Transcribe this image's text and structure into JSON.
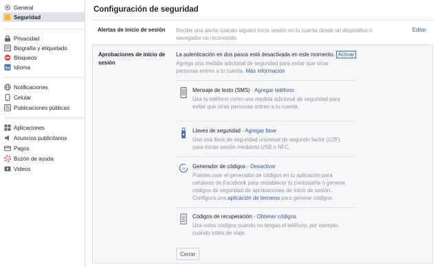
{
  "sidebar": {
    "items": [
      {
        "label": "General",
        "icon": "gear-icon"
      },
      {
        "label": "Seguridad",
        "icon": "shield-icon"
      },
      {
        "label": "Privacidad",
        "icon": "lock-icon"
      },
      {
        "label": "Biografía y etiquetado",
        "icon": "timeline-icon"
      },
      {
        "label": "Bloqueos",
        "icon": "block-icon"
      },
      {
        "label": "Idioma",
        "icon": "language-icon"
      },
      {
        "label": "Notificaciones",
        "icon": "globe-icon"
      },
      {
        "label": "Celular",
        "icon": "mobile-icon"
      },
      {
        "label": "Publicaciones públicas",
        "icon": "rss-icon"
      },
      {
        "label": "Aplicaciones",
        "icon": "apps-icon"
      },
      {
        "label": "Anuncios publicitarios",
        "icon": "ads-icon"
      },
      {
        "label": "Pagos",
        "icon": "card-icon"
      },
      {
        "label": "Buzón de ayuda",
        "icon": "help-icon"
      },
      {
        "label": "Videos",
        "icon": "video-icon"
      }
    ]
  },
  "main": {
    "title": "Configuración de seguridad",
    "alerts": {
      "label": "Alertas de inicio de sesión",
      "description": "Recibe una alerta cuando alguien inicie sesión en tu cuenta desde un dispositivo o navegador no reconocido.",
      "edit": "Editar"
    },
    "approvals": {
      "label": "Aprobaciones de inicio de sesión",
      "status": "La autenticación en dos pasos está desactivada en este momento.",
      "activate": "Activar",
      "description": "Agrega una medida adicional de seguridad para evitar que otras personas entren a tu cuenta.",
      "more_info": "Más información",
      "methods": [
        {
          "title": "Mensaje de texto (SMS)",
          "sep": " · ",
          "action": "Agregar teléfono",
          "description": "Usa tu teléfono como una medida adicional de seguridad para evitar que otras personas entren a tu cuenta.",
          "icon": "phone-icon"
        },
        {
          "title": "Llaves de seguridad",
          "sep": " · ",
          "action": "Agregar llave",
          "description": "Usa una llave de seguridad universal de segundo factor (U2F) para iniciar sesión mediante USB o NFC.",
          "icon": "usb-key-icon"
        },
        {
          "title": "Generador de códigos",
          "sep": " · ",
          "action": "Desactivar",
          "description_pre": "Puedes usar el generador de códigos en tu aplicación para celulares de Facebook para restablecer tu contraseña o generar códigos de seguridad de aprobaciones de inicio de sesión. Configura una ",
          "description_link": "aplicación de terceros",
          "description_post": " para generar códigos",
          "icon": "code-generator-icon"
        },
        {
          "title": "Códigos de recuperación",
          "sep": " · ",
          "action": "Obtener códigos",
          "description": "Usa estos códigos cuando no tengas el teléfono, por ejemplo, cuando estés de viaje.",
          "icon": "recovery-codes-icon"
        }
      ],
      "close": "Cerrar"
    }
  }
}
